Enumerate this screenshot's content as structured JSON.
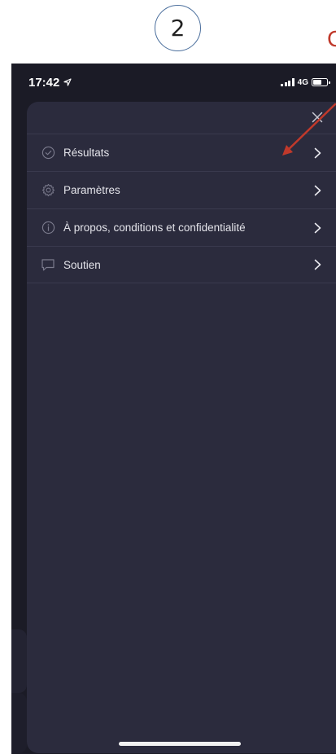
{
  "annotation": {
    "step_number": "2",
    "partial_letter": "C"
  },
  "status_bar": {
    "time": "17:42",
    "network": "4G",
    "icons": [
      "location-arrow-icon",
      "signal-bars-icon",
      "battery-icon"
    ]
  },
  "menu": {
    "items": [
      {
        "label": "Résultats",
        "icon": "check-circle-icon"
      },
      {
        "label": "Paramètres",
        "icon": "gear-icon"
      },
      {
        "label": "À propos, conditions et confidentialité",
        "icon": "info-circle-icon"
      },
      {
        "label": "Soutien",
        "icon": "chat-bubble-icon"
      }
    ]
  },
  "colors": {
    "phone_background": "#1b1b26",
    "sheet_background": "#2b2b3d",
    "annotation_red": "#c0392b",
    "annotation_circle": "#4a6e9c"
  }
}
